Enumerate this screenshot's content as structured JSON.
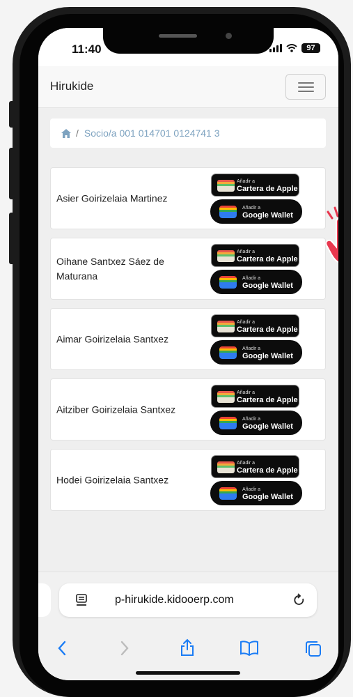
{
  "status_bar": {
    "time": "11:40",
    "battery": "97"
  },
  "navbar": {
    "brand": "Hirukide"
  },
  "breadcrumb": {
    "separator": "/",
    "current": "Socio/a 001 014701 0124741 3"
  },
  "wallet_buttons": {
    "apple_small": "Añadir a",
    "apple_main": "Cartera de Apple",
    "google_small": "Añadir a",
    "google_main": "Google Wallet"
  },
  "members": [
    {
      "name": "Asier Goirizelaia Martinez"
    },
    {
      "name": "Oihane Santxez Sáez de Maturana"
    },
    {
      "name": "Aimar Goirizelaia Santxez"
    },
    {
      "name": "Aitziber Goirizelaia Santxez"
    },
    {
      "name": "Hodei Goirizelaia Santxez"
    }
  ],
  "browser": {
    "url": "p-hirukide.kidooerp.com"
  },
  "icons": {
    "home": "home-icon",
    "menu": "hamburger-icon",
    "pointer": "hand-pointer-icon",
    "reader": "reader-icon",
    "reload": "reload-icon",
    "back": "back-chevron-icon",
    "forward": "forward-chevron-icon",
    "share": "share-icon",
    "bookmarks": "book-icon",
    "tabs": "tabs-icon"
  },
  "colors": {
    "link": "#7ea3c0",
    "ios_blue": "#1a7cf5",
    "pointer": "#e8384f"
  }
}
